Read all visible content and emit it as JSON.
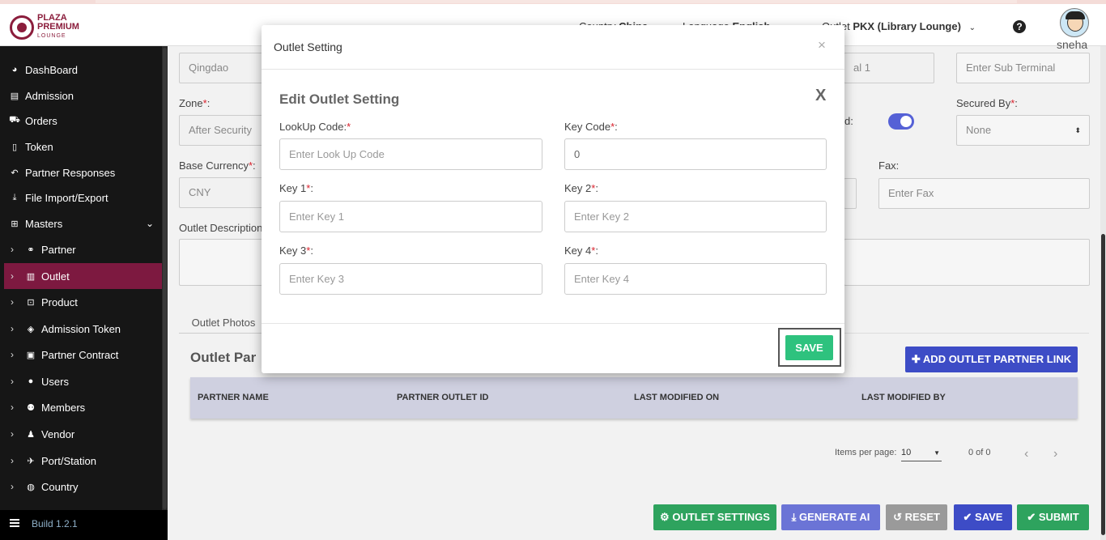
{
  "header": {
    "logo_line1": "PLAZA",
    "logo_line2": "PREMIUM",
    "logo_line3": "LOUNGE",
    "country_label": "Country",
    "country_value": "China",
    "language_label": "Language",
    "language_value": "English",
    "outlet_label": "Outlet",
    "outlet_value": "PKX (Library Lounge)",
    "help_glyph": "?",
    "username": "sneha"
  },
  "sidebar": {
    "items": [
      {
        "label": "DashBoard",
        "icon": "dashboard-icon",
        "glyph": "◕"
      },
      {
        "label": "Admission",
        "icon": "id-card-icon",
        "glyph": "▤"
      },
      {
        "label": "Orders",
        "icon": "cart-icon",
        "glyph": "⛟"
      },
      {
        "label": "Token",
        "icon": "file-icon",
        "glyph": "▯"
      },
      {
        "label": "Partner Responses",
        "icon": "reply-icon",
        "glyph": "↶"
      },
      {
        "label": "File Import/Export",
        "icon": "download-icon",
        "glyph": "⤓"
      },
      {
        "label": "Masters",
        "icon": "sitemap-icon",
        "glyph": "⊞"
      }
    ],
    "subitems": [
      {
        "label": "Partner",
        "icon": "handshake-icon",
        "glyph": "⚭"
      },
      {
        "label": "Outlet",
        "icon": "building-icon",
        "glyph": "▥"
      },
      {
        "label": "Product",
        "icon": "gift-icon",
        "glyph": "⊡"
      },
      {
        "label": "Admission Token",
        "icon": "tag-icon",
        "glyph": "◈"
      },
      {
        "label": "Partner Contract",
        "icon": "briefcase-icon",
        "glyph": "▣"
      },
      {
        "label": "Users",
        "icon": "user-icon",
        "glyph": "●"
      },
      {
        "label": "Members",
        "icon": "users-icon",
        "glyph": "⚉"
      },
      {
        "label": "Vendor",
        "icon": "person-icon",
        "glyph": "♟"
      },
      {
        "label": "Port/Station",
        "icon": "plane-icon",
        "glyph": "✈"
      },
      {
        "label": "Country",
        "icon": "globe-icon",
        "glyph": "◍"
      }
    ],
    "build": "Build 1.2.1"
  },
  "form": {
    "city_value": "Qingdao",
    "terminal_value": "al 1",
    "sub_terminal_placeholder": "Enter Sub Terminal",
    "zone_label": "Zone",
    "zone_value": "After Security",
    "d_label": "d:",
    "secured_by_label": "Secured By",
    "secured_by_value": "None",
    "base_currency_label": "Base Currency",
    "base_currency_value": "CNY",
    "fax_label": "Fax:",
    "fax_placeholder": "Enter Fax",
    "outlet_description_label": "Outlet Description",
    "tab_photos": "Outlet Photos",
    "section_title": "Outlet Par",
    "add_link_button": "ADD OUTLET PARTNER LINK",
    "table_headers": [
      "PARTNER NAME",
      "PARTNER OUTLET ID",
      "LAST MODIFIED ON",
      "LAST MODIFIED BY"
    ],
    "items_per_page_label": "Items per page:",
    "items_per_page_value": "10",
    "range_label": "0 of 0"
  },
  "bottom_buttons": {
    "outlet_settings": "OUTLET SETTINGS",
    "generate_ai": "GENERATE AI",
    "reset": "RESET",
    "save": "SAVE",
    "submit": "SUBMIT"
  },
  "modal": {
    "title": "Outlet Setting",
    "close_glyph": "×",
    "subtitle": "Edit Outlet Setting",
    "x_glyph": "X",
    "fields": {
      "lookup_label": "LookUp Code:",
      "lookup_placeholder": "Enter Look Up Code",
      "keycode_label": "Key Code",
      "keycode_value": "0",
      "key1_label": "Key 1",
      "key1_placeholder": "Enter Key 1",
      "key2_label": "Key 2",
      "key2_placeholder": "Enter Key 2",
      "key3_label": "Key 3",
      "key3_placeholder": "Enter Key 3",
      "key4_label": "Key 4",
      "key4_placeholder": "Enter Key 4"
    },
    "save_label": "SAVE"
  },
  "colors": {
    "brand": "#8b1d3c",
    "sidebar_active": "#7d1940",
    "primary": "#3d4cc6",
    "success": "#2ec27e"
  }
}
